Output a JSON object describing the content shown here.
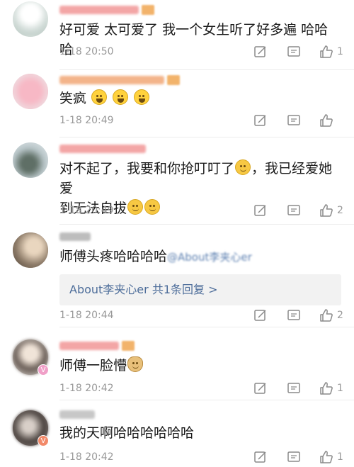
{
  "comments": [
    {
      "text": "好可爱 太可爱了  我一个女生听了好多遍 哈哈哈",
      "time": "1-18 20:50",
      "likes": "1",
      "avatar_color": "#dfe6e3",
      "name_color": "#f3a6a6"
    },
    {
      "text": "笑疯",
      "emoji": [
        "laugh-emoji",
        "laugh-emoji",
        "laugh-emoji"
      ],
      "time": "1-18 20:49",
      "likes": "",
      "avatar_color": "#f4c7cf",
      "name_color": "#f3b48a"
    },
    {
      "text_a": "对不起了，我要和你抢叮叮了",
      "text_b": "，我已经爱她爱",
      "text_c": "到无法自拔",
      "time": "1-18 20:49",
      "likes": "2",
      "avatar_color": "#cfd8dc",
      "name_color": "#f3a6a6"
    },
    {
      "text": "师傅头疼哈哈哈哈",
      "mention": "@About李夹心er",
      "reply": "About李夹心er  共1条回复 >",
      "time": "1-18 20:44",
      "likes": "2",
      "avatar_color": "#8c7a67",
      "name_color": "#bdbdbd"
    },
    {
      "text": "师傅一脸懵",
      "time": "1-18 20:42",
      "likes": "1",
      "avatar_color": "#b9b3ad",
      "name_color": "#f3a6a6"
    },
    {
      "text": "我的天啊哈哈哈哈哈哈",
      "time": "1-18 20:42",
      "likes": "1",
      "avatar_color": "#6e6460",
      "name_color": "#c7c7c7"
    }
  ],
  "icons": {
    "repost": "repost-icon",
    "comment": "comment-icon",
    "like": "like-icon"
  },
  "colors": {
    "time": "#999999",
    "link": "#4d6d9a",
    "icon": "#8a8a8a"
  }
}
